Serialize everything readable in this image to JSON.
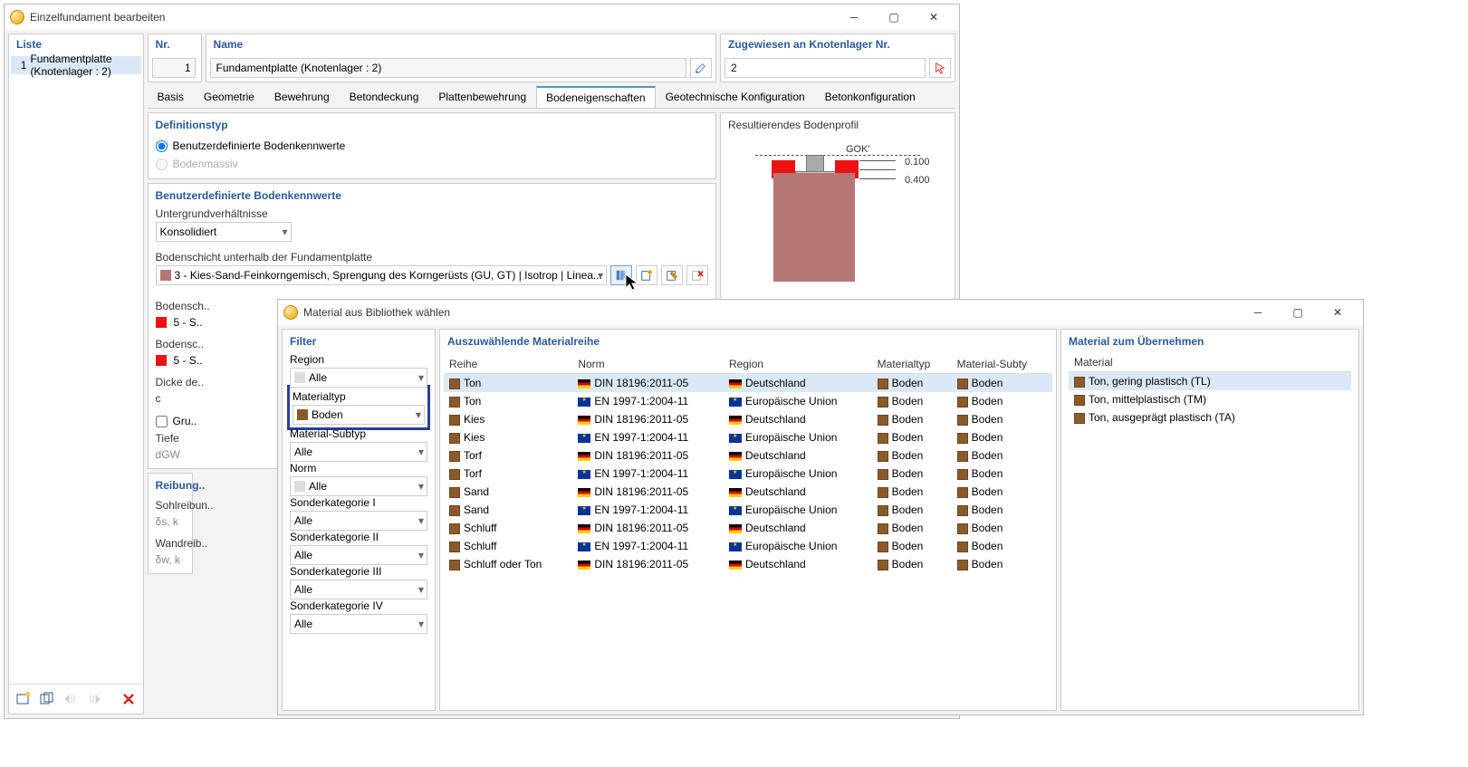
{
  "main_window": {
    "title": "Einzelfundament bearbeiten",
    "list": {
      "header": "Liste",
      "item_num": "1",
      "item_label": "Fundamentplatte (Knotenlager : 2)"
    },
    "nr": {
      "header": "Nr.",
      "value": "1"
    },
    "name": {
      "header": "Name",
      "value": "Fundamentplatte (Knotenlager : 2)"
    },
    "assigned": {
      "header": "Zugewiesen an Knotenlager Nr.",
      "value": "2"
    },
    "tabs": [
      "Basis",
      "Geometrie",
      "Bewehrung",
      "Betondeckung",
      "Plattenbewehrung",
      "Bodeneigenschaften",
      "Geotechnische Konfiguration",
      "Betonkonfiguration"
    ],
    "active_tab": 5,
    "definitionstyp": {
      "title": "Definitionstyp",
      "opt1": "Benutzerdefinierte Bodenkennwerte",
      "opt2": "Bodenmassiv"
    },
    "custom_soil": {
      "title": "Benutzerdefinierte Bodenkennwerte",
      "underground_label": "Untergrundverhältnisse",
      "underground_value": "Konsolidiert",
      "layer_below_label": "Bodenschicht unterhalb der Fundamentplatte",
      "layer_below_value": "3 - Kies-Sand-Feinkorngemisch, Sprengung des Korngerüsts (GU, GT) | Isotrop | Linea...",
      "layer_partial_labels": [
        "Bodensch..",
        "5 - S..",
        "Bodensc..",
        "5 - S..",
        "Dicke de..",
        "c",
        "Gru..",
        "Tiefe",
        "dGW"
      ]
    },
    "profile": {
      "title": "Resultierendes Bodenprofil",
      "gok": "GOK'",
      "d1": "0.100",
      "d2": "0.400"
    },
    "friction": {
      "title": "Reibung..",
      "rows": [
        "Sohlreibun..",
        "δs, k",
        "Wandreib..",
        "δw, k"
      ]
    }
  },
  "lib_window": {
    "title": "Material aus Bibliothek wählen",
    "filter": {
      "title": "Filter",
      "region_label": "Region",
      "region_value": "Alle",
      "mattype_label": "Materialtyp",
      "mattype_value": "Boden",
      "subtype_label": "Material-Subtyp",
      "subtype_value": "Alle",
      "norm_label": "Norm",
      "norm_value": "Alle",
      "sk1_label": "Sonderkategorie I",
      "sk1_value": "Alle",
      "sk2_label": "Sonderkategorie II",
      "sk2_value": "Alle",
      "sk3_label": "Sonderkategorie III",
      "sk3_value": "Alle",
      "sk4_label": "Sonderkategorie IV",
      "sk4_value": "Alle"
    },
    "series": {
      "title": "Auszuwählende Materialreihe",
      "cols": [
        "Reihe",
        "Norm",
        "Region",
        "Materialtyp",
        "Material-Subty"
      ],
      "rows": [
        {
          "reihe": "Ton",
          "norm": "DIN 18196:2011-05",
          "region": "Deutschland",
          "flag": "de",
          "mt": "Boden",
          "ms": "Boden",
          "sel": true
        },
        {
          "reihe": "Ton",
          "norm": "EN 1997-1:2004-11",
          "region": "Europäische Union",
          "flag": "eu",
          "mt": "Boden",
          "ms": "Boden"
        },
        {
          "reihe": "Kies",
          "norm": "DIN 18196:2011-05",
          "region": "Deutschland",
          "flag": "de",
          "mt": "Boden",
          "ms": "Boden"
        },
        {
          "reihe": "Kies",
          "norm": "EN 1997-1:2004-11",
          "region": "Europäische Union",
          "flag": "eu",
          "mt": "Boden",
          "ms": "Boden"
        },
        {
          "reihe": "Torf",
          "norm": "DIN 18196:2011-05",
          "region": "Deutschland",
          "flag": "de",
          "mt": "Boden",
          "ms": "Boden"
        },
        {
          "reihe": "Torf",
          "norm": "EN 1997-1:2004-11",
          "region": "Europäische Union",
          "flag": "eu",
          "mt": "Boden",
          "ms": "Boden"
        },
        {
          "reihe": "Sand",
          "norm": "DIN 18196:2011-05",
          "region": "Deutschland",
          "flag": "de",
          "mt": "Boden",
          "ms": "Boden"
        },
        {
          "reihe": "Sand",
          "norm": "EN 1997-1:2004-11",
          "region": "Europäische Union",
          "flag": "eu",
          "mt": "Boden",
          "ms": "Boden"
        },
        {
          "reihe": "Schluff",
          "norm": "DIN 18196:2011-05",
          "region": "Deutschland",
          "flag": "de",
          "mt": "Boden",
          "ms": "Boden"
        },
        {
          "reihe": "Schluff",
          "norm": "EN 1997-1:2004-11",
          "region": "Europäische Union",
          "flag": "eu",
          "mt": "Boden",
          "ms": "Boden"
        },
        {
          "reihe": "Schluff oder Ton",
          "norm": "DIN 18196:2011-05",
          "region": "Deutschland",
          "flag": "de",
          "mt": "Boden",
          "ms": "Boden"
        }
      ]
    },
    "takeover": {
      "title": "Material zum Übernehmen",
      "col": "Material",
      "rows": [
        {
          "name": "Ton, gering plastisch (TL)",
          "sel": true
        },
        {
          "name": "Ton, mittelplastisch (TM)"
        },
        {
          "name": "Ton, ausgeprägt plastisch (TA)"
        }
      ]
    }
  }
}
